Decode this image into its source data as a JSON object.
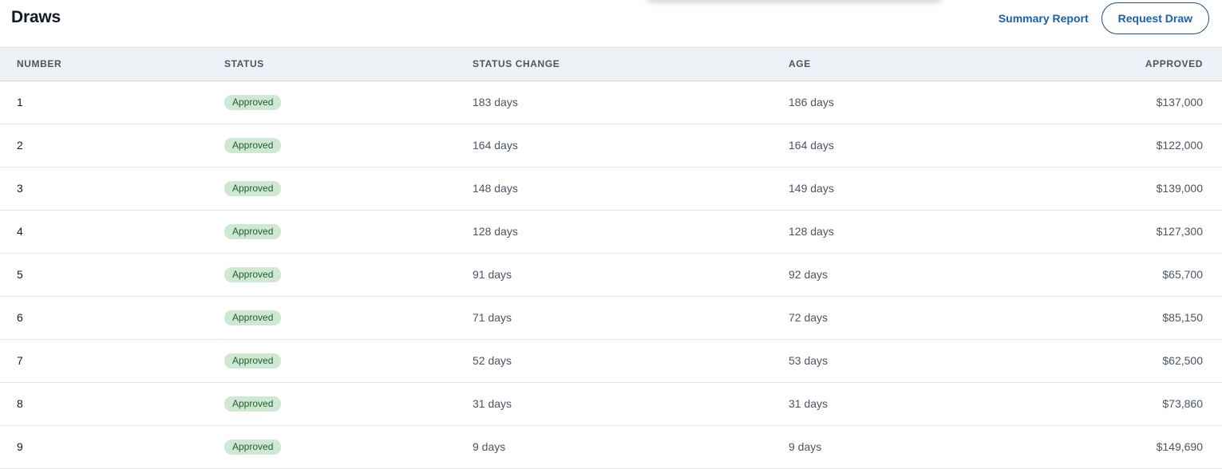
{
  "header": {
    "title": "Draws",
    "summary_report_label": "Summary Report",
    "request_draw_label": "Request Draw"
  },
  "table": {
    "columns": [
      "NUMBER",
      "STATUS",
      "STATUS CHANGE",
      "AGE",
      "APPROVED"
    ],
    "rows": [
      {
        "number": "1",
        "status": "Approved",
        "status_change": "183 days",
        "age": "186 days",
        "approved": "$137,000"
      },
      {
        "number": "2",
        "status": "Approved",
        "status_change": "164 days",
        "age": "164 days",
        "approved": "$122,000"
      },
      {
        "number": "3",
        "status": "Approved",
        "status_change": "148 days",
        "age": "149 days",
        "approved": "$139,000"
      },
      {
        "number": "4",
        "status": "Approved",
        "status_change": "128 days",
        "age": "128 days",
        "approved": "$127,300"
      },
      {
        "number": "5",
        "status": "Approved",
        "status_change": "91 days",
        "age": "92 days",
        "approved": "$65,700"
      },
      {
        "number": "6",
        "status": "Approved",
        "status_change": "71 days",
        "age": "72 days",
        "approved": "$85,150"
      },
      {
        "number": "7",
        "status": "Approved",
        "status_change": "52 days",
        "age": "53 days",
        "approved": "$62,500"
      },
      {
        "number": "8",
        "status": "Approved",
        "status_change": "31 days",
        "age": "31 days",
        "approved": "$73,860"
      },
      {
        "number": "9",
        "status": "Approved",
        "status_change": "9 days",
        "age": "9 days",
        "approved": "$149,690"
      }
    ]
  },
  "colors": {
    "accent": "#1b5fae",
    "badge_bg": "#cfe8d3",
    "badge_text": "#1f5e2c",
    "header_bg": "#eef2f6"
  }
}
